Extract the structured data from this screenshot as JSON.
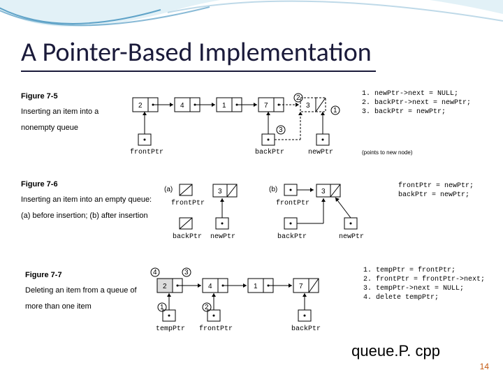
{
  "title": "A Pointer-Based Implementation",
  "fig75": {
    "label": "Figure 7-5",
    "caption": "Inserting an item into a nonempty queue",
    "nodes": [
      "2",
      "4",
      "1",
      "7",
      "3"
    ],
    "frontPtr": "frontPtr",
    "backPtr": "backPtr",
    "newPtr": "newPtr",
    "newPtrNote": "(points to new node)",
    "steps": [
      "1.  newPtr->next = NULL;",
      "2.  backPtr->next = newPtr;",
      "3.  backPtr = newPtr;"
    ],
    "circles": [
      "1",
      "2",
      "3"
    ]
  },
  "fig76": {
    "label": "Figure 7-6",
    "caption": "Inserting an item into an empty queue: (a) before insertion; (b) after insertion",
    "a": "(a)",
    "b": "(b)",
    "val": "3",
    "frontPtr": "frontPtr",
    "backPtr": "backPtr",
    "newPtr": "newPtr",
    "steps": [
      "frontPtr = newPtr;",
      "backPtr = newPtr;"
    ]
  },
  "fig77": {
    "label": "Figure 7-7",
    "caption": "Deleting an item from a queue of more than one item",
    "nodes": [
      "2",
      "4",
      "1",
      "7"
    ],
    "tempPtr": "tempPtr",
    "frontPtr": "frontPtr",
    "backPtr": "backPtr",
    "steps": [
      "1.  tempPtr = frontPtr;",
      "2.  frontPtr = frontPtr->next;",
      "3.  tempPtr->next = NULL;",
      "4.  delete tempPtr;"
    ],
    "circles": [
      "1",
      "2",
      "3",
      "4"
    ]
  },
  "filename": "queue.P. cpp",
  "pageNum": "14"
}
